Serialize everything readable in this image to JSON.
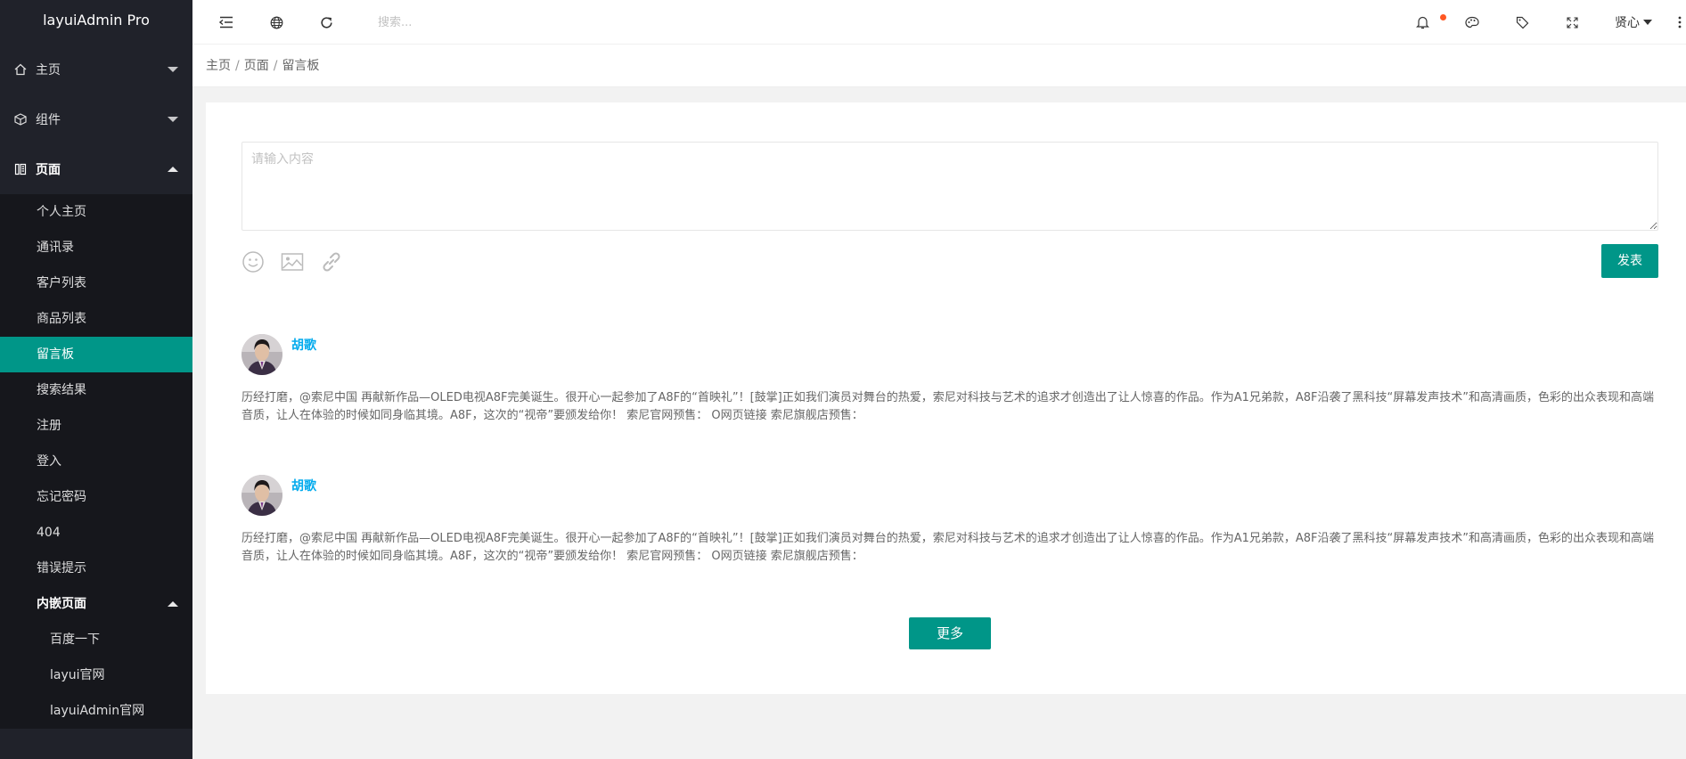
{
  "app": {
    "title": "layuiAdmin Pro"
  },
  "sidebar": {
    "top_items": [
      {
        "label": "主页",
        "icon": "home-icon"
      },
      {
        "label": "组件",
        "icon": "cube-icon"
      },
      {
        "label": "页面",
        "icon": "pages-icon"
      }
    ],
    "page_items": [
      {
        "label": "个人主页"
      },
      {
        "label": "通讯录"
      },
      {
        "label": "客户列表"
      },
      {
        "label": "商品列表"
      },
      {
        "label": "留言板",
        "active": true
      },
      {
        "label": "搜索结果"
      },
      {
        "label": "注册"
      },
      {
        "label": "登入"
      },
      {
        "label": "忘记密码"
      },
      {
        "label": "404"
      },
      {
        "label": "错误提示"
      },
      {
        "label": "内嵌页面"
      }
    ],
    "embedded_items": [
      {
        "label": "百度一下"
      },
      {
        "label": "layui官网"
      },
      {
        "label": "layuiAdmin官网"
      }
    ]
  },
  "header": {
    "search_placeholder": "搜索...",
    "user_name": "贤心",
    "icons": [
      "shrink-menu-icon",
      "globe-icon",
      "refresh-icon",
      "bell-icon",
      "theme-icon",
      "tag-icon",
      "fullscreen-icon",
      "more-icon"
    ]
  },
  "breadcrumb": {
    "items": [
      "主页",
      "页面",
      "留言板"
    ],
    "separator": "/"
  },
  "editor": {
    "placeholder": "请输入内容",
    "post_label": "发表",
    "tool_icons": [
      "emoji-icon",
      "image-icon",
      "link-icon"
    ]
  },
  "comments": [
    {
      "author": "胡歌",
      "text": "历经打磨，@索尼中国 再献新作品—OLED电视A8F完美诞生。很开心一起参加了A8F的“首映礼”！[鼓掌]正如我们演员对舞台的热爱，索尼对科技与艺术的追求才创造出了让人惊喜的作品。作为A1兄弟款，A8F沿袭了黑科技“屏幕发声技术”和高清画质，色彩的出众表现和高端音质，让人在体验的时候如同身临其境。A8F，这次的“视帝”要颁发给你！ 索尼官网预售： O网页链接 索尼旗舰店预售："
    },
    {
      "author": "胡歌",
      "text": "历经打磨，@索尼中国 再献新作品—OLED电视A8F完美诞生。很开心一起参加了A8F的“首映礼”！[鼓掌]正如我们演员对舞台的热爱，索尼对科技与艺术的追求才创造出了让人惊喜的作品。作为A1兄弟款，A8F沿袭了黑科技“屏幕发声技术”和高清画质，色彩的出众表现和高端音质，让人在体验的时候如同身临其境。A8F，这次的“视帝”要颁发给你！ 索尼官网预售： O网页链接 索尼旗舰店预售："
    }
  ],
  "more_label": "更多",
  "colors": {
    "accent": "#009688",
    "sidebar_bg": "#20222a",
    "submenu_bg": "#16171c",
    "link": "#01aaed",
    "dot": "#ff5722"
  }
}
